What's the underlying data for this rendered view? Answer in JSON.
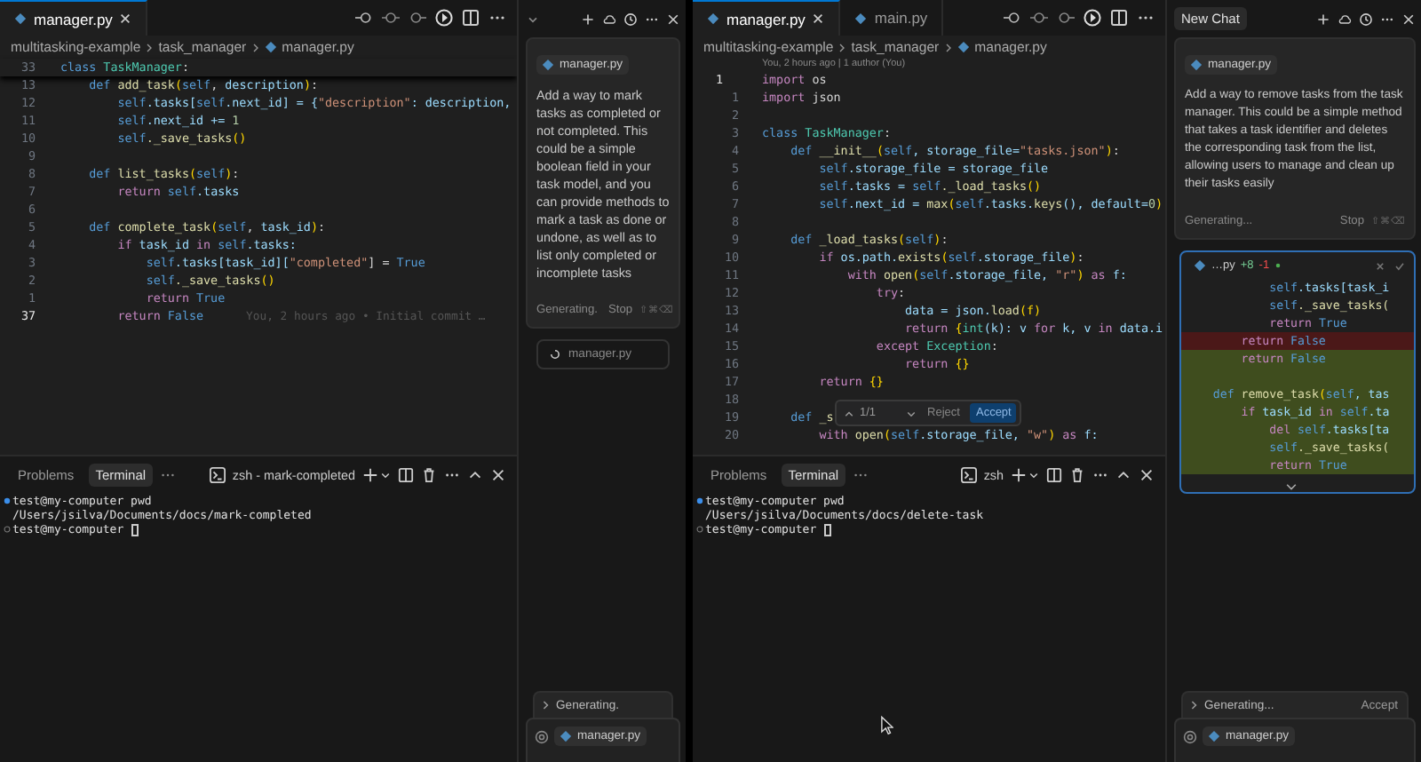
{
  "panes": [
    {
      "editor": {
        "tabs": [
          {
            "label": "manager.py",
            "selected": true
          }
        ],
        "breadcrumbs": [
          "multitasking-example",
          "task_manager",
          "manager.py"
        ],
        "lines": [
          {
            "number": "33",
            "current": false,
            "tokens": [
              {
                "text": "class ",
                "kind": "kw"
              },
              {
                "text": "TaskManager",
                "kind": "cls"
              },
              {
                "text": ":",
                "kind": "pl"
              }
            ]
          },
          {
            "number": "13",
            "current": false,
            "tokens": [
              {
                "text": "    def ",
                "kind": "kw"
              },
              {
                "text": "add_task",
                "kind": "fn"
              },
              {
                "text": "(",
                "kind": "br"
              },
              {
                "text": "self",
                "kind": "kw"
              },
              {
                "text": ", ",
                "kind": "pl"
              },
              {
                "text": "description",
                "kind": "var"
              },
              {
                "text": ")",
                "kind": "br"
              },
              {
                "text": ":",
                "kind": "pl"
              }
            ]
          },
          {
            "number": "12",
            "current": false,
            "tokens": [
              {
                "text": "        self",
                "kind": "kw"
              },
              {
                "text": ".tasks[",
                "kind": "var"
              },
              {
                "text": "self",
                "kind": "kw"
              },
              {
                "text": ".next_id] = {",
                "kind": "var"
              },
              {
                "text": "\"description\"",
                "kind": "str"
              },
              {
                "text": ": description,",
                "kind": "var"
              }
            ]
          },
          {
            "number": "11",
            "current": false,
            "tokens": [
              {
                "text": "        self",
                "kind": "kw"
              },
              {
                "text": ".next_id += ",
                "kind": "var"
              },
              {
                "text": "1",
                "kind": "num"
              }
            ]
          },
          {
            "number": "10",
            "current": false,
            "tokens": [
              {
                "text": "        self",
                "kind": "kw"
              },
              {
                "text": "._save_tasks",
                "kind": "fn"
              },
              {
                "text": "()",
                "kind": "br"
              }
            ]
          },
          {
            "number": "9",
            "current": false
          },
          {
            "number": "8",
            "current": false,
            "tokens": [
              {
                "text": "    def ",
                "kind": "kw"
              },
              {
                "text": "list_tasks",
                "kind": "fn"
              },
              {
                "text": "(",
                "kind": "br"
              },
              {
                "text": "self",
                "kind": "kw"
              },
              {
                "text": ")",
                "kind": "br"
              },
              {
                "text": ":",
                "kind": "pl"
              }
            ]
          },
          {
            "number": "7",
            "current": false,
            "tokens": [
              {
                "text": "        return ",
                "kind": "ctl"
              },
              {
                "text": "self",
                "kind": "kw"
              },
              {
                "text": ".tasks",
                "kind": "var"
              }
            ]
          },
          {
            "number": "6",
            "current": false
          },
          {
            "number": "5",
            "current": false,
            "tokens": [
              {
                "text": "    def ",
                "kind": "kw"
              },
              {
                "text": "complete_task",
                "kind": "fn"
              },
              {
                "text": "(",
                "kind": "br"
              },
              {
                "text": "self",
                "kind": "kw"
              },
              {
                "text": ", ",
                "kind": "pl"
              },
              {
                "text": "task_id",
                "kind": "var"
              },
              {
                "text": ")",
                "kind": "br"
              },
              {
                "text": ":",
                "kind": "pl"
              }
            ]
          },
          {
            "number": "4",
            "current": false,
            "tokens": [
              {
                "text": "        if ",
                "kind": "ctl"
              },
              {
                "text": "task_id ",
                "kind": "var"
              },
              {
                "text": "in ",
                "kind": "ctl"
              },
              {
                "text": "self",
                "kind": "kw"
              },
              {
                "text": ".tasks:",
                "kind": "var"
              }
            ]
          },
          {
            "number": "3",
            "current": false,
            "tokens": [
              {
                "text": "            self",
                "kind": "kw"
              },
              {
                "text": ".tasks[task_id][",
                "kind": "var"
              },
              {
                "text": "\"completed\"",
                "kind": "str"
              },
              {
                "text": "] = ",
                "kind": "pl"
              },
              {
                "text": "True",
                "kind": "kw"
              }
            ]
          },
          {
            "number": "2",
            "current": false,
            "tokens": [
              {
                "text": "            self",
                "kind": "kw"
              },
              {
                "text": "._save_tasks",
                "kind": "fn"
              },
              {
                "text": "()",
                "kind": "br"
              }
            ]
          },
          {
            "number": "1",
            "current": false,
            "tokens": [
              {
                "text": "            return ",
                "kind": "ctl"
              },
              {
                "text": "True",
                "kind": "kw"
              }
            ]
          },
          {
            "number": "37",
            "current": true,
            "tokens": [
              {
                "text": "        return ",
                "kind": "ctl"
              },
              {
                "text": "False",
                "kind": "kw"
              }
            ],
            "blame": "You, 2 hours ago • Initial commit …"
          }
        ]
      },
      "terminal": {
        "tabs": [
          {
            "label": "Problems",
            "selected": false
          },
          {
            "label": "Terminal",
            "selected": true
          }
        ],
        "shell": "zsh - mark-completed",
        "lines": [
          {
            "kind": "command",
            "text": "test@my-computer pwd"
          },
          {
            "kind": "output",
            "text": "/Users/jsilva/Documents/docs/mark-completed"
          },
          {
            "kind": "prompt",
            "text": "test@my-computer"
          }
        ]
      },
      "chat": {
        "message": {
          "file": "manager.py",
          "text": "Add a way to mark tasks as completed or not completed. This could be a simple boolean field in your task model, and you can provide methods to mark a task as done or undone, as well as to list only completed or incomplete tasks",
          "status": "Generating.",
          "stop": "Stop",
          "shortcut": "⇧⌘⌫"
        },
        "pending_file": "manager.py",
        "footer": {
          "status": "Generating."
        },
        "composer": {
          "file": "manager.py"
        }
      }
    },
    {
      "editor": {
        "tabs": [
          {
            "label": "manager.py",
            "selected": true
          },
          {
            "label": "main.py",
            "selected": false
          }
        ],
        "breadcrumbs": [
          "multitasking-example",
          "task_manager",
          "manager.py"
        ],
        "blame_header": "You, 2 hours ago | 1 author (You)",
        "lines": [
          {
            "number": "1",
            "current": true,
            "tokens": [
              {
                "text": "import ",
                "kind": "ctl"
              },
              {
                "text": "os",
                "kind": "pl"
              }
            ]
          },
          {
            "number": "1",
            "current": false,
            "tokens": [
              {
                "text": "import ",
                "kind": "ctl"
              },
              {
                "text": "json",
                "kind": "pl"
              }
            ]
          },
          {
            "number": "2",
            "current": false
          },
          {
            "number": "3",
            "current": false,
            "tokens": [
              {
                "text": "class ",
                "kind": "kw"
              },
              {
                "text": "TaskManager",
                "kind": "cls"
              },
              {
                "text": ":",
                "kind": "pl"
              }
            ]
          },
          {
            "number": "4",
            "current": false,
            "tokens": [
              {
                "text": "    def ",
                "kind": "kw"
              },
              {
                "text": "__init__",
                "kind": "fn"
              },
              {
                "text": "(",
                "kind": "br"
              },
              {
                "text": "self",
                "kind": "kw"
              },
              {
                "text": ", storage_file=",
                "kind": "var"
              },
              {
                "text": "\"tasks.json\"",
                "kind": "str"
              },
              {
                "text": ")",
                "kind": "br"
              },
              {
                "text": ":",
                "kind": "pl"
              }
            ]
          },
          {
            "number": "5",
            "current": false,
            "tokens": [
              {
                "text": "        self",
                "kind": "kw"
              },
              {
                "text": ".storage_file = storage_file",
                "kind": "var"
              }
            ]
          },
          {
            "number": "6",
            "current": false,
            "tokens": [
              {
                "text": "        self",
                "kind": "kw"
              },
              {
                "text": ".tasks = ",
                "kind": "var"
              },
              {
                "text": "self",
                "kind": "kw"
              },
              {
                "text": "._load_tasks",
                "kind": "fn"
              },
              {
                "text": "()",
                "kind": "br"
              }
            ]
          },
          {
            "number": "7",
            "current": false,
            "tokens": [
              {
                "text": "        self",
                "kind": "kw"
              },
              {
                "text": ".next_id = ",
                "kind": "var"
              },
              {
                "text": "max",
                "kind": "fn"
              },
              {
                "text": "(",
                "kind": "br"
              },
              {
                "text": "self",
                "kind": "kw"
              },
              {
                "text": ".tasks.",
                "kind": "var"
              },
              {
                "text": "keys",
                "kind": "fn"
              },
              {
                "text": "(), default=",
                "kind": "var"
              },
              {
                "text": "0",
                "kind": "num"
              },
              {
                "text": ")",
                "kind": "br"
              }
            ]
          },
          {
            "number": "8",
            "current": false
          },
          {
            "number": "9",
            "current": false,
            "tokens": [
              {
                "text": "    def ",
                "kind": "kw"
              },
              {
                "text": "_load_tasks",
                "kind": "fn"
              },
              {
                "text": "(",
                "kind": "br"
              },
              {
                "text": "self",
                "kind": "kw"
              },
              {
                "text": ")",
                "kind": "br"
              },
              {
                "text": ":",
                "kind": "pl"
              }
            ]
          },
          {
            "number": "10",
            "current": false,
            "tokens": [
              {
                "text": "        if ",
                "kind": "ctl"
              },
              {
                "text": "os.path.",
                "kind": "var"
              },
              {
                "text": "exists",
                "kind": "fn"
              },
              {
                "text": "(",
                "kind": "br"
              },
              {
                "text": "self",
                "kind": "kw"
              },
              {
                "text": ".storage_file",
                "kind": "var"
              },
              {
                "text": ")",
                "kind": "br"
              },
              {
                "text": ":",
                "kind": "pl"
              }
            ]
          },
          {
            "number": "11",
            "current": false,
            "tokens": [
              {
                "text": "            with ",
                "kind": "ctl"
              },
              {
                "text": "open",
                "kind": "fn"
              },
              {
                "text": "(",
                "kind": "br"
              },
              {
                "text": "self",
                "kind": "kw"
              },
              {
                "text": ".storage_file, ",
                "kind": "var"
              },
              {
                "text": "\"r\"",
                "kind": "str"
              },
              {
                "text": ") ",
                "kind": "br"
              },
              {
                "text": "as ",
                "kind": "ctl"
              },
              {
                "text": "f:",
                "kind": "var"
              }
            ]
          },
          {
            "number": "12",
            "current": false,
            "tokens": [
              {
                "text": "                try",
                "kind": "ctl"
              },
              {
                "text": ":",
                "kind": "pl"
              }
            ]
          },
          {
            "number": "13",
            "current": false,
            "tokens": [
              {
                "text": "                    data = json.",
                "kind": "var"
              },
              {
                "text": "load",
                "kind": "fn"
              },
              {
                "text": "(f)",
                "kind": "br"
              }
            ]
          },
          {
            "number": "14",
            "current": false,
            "tokens": [
              {
                "text": "                    return ",
                "kind": "ctl"
              },
              {
                "text": "{",
                "kind": "br"
              },
              {
                "text": "int",
                "kind": "cls"
              },
              {
                "text": "(k): v ",
                "kind": "var"
              },
              {
                "text": "for ",
                "kind": "ctl"
              },
              {
                "text": "k, v ",
                "kind": "var"
              },
              {
                "text": "in ",
                "kind": "ctl"
              },
              {
                "text": "data.i",
                "kind": "var"
              }
            ]
          },
          {
            "number": "15",
            "current": false,
            "tokens": [
              {
                "text": "                except ",
                "kind": "ctl"
              },
              {
                "text": "Exception",
                "kind": "cls"
              },
              {
                "text": ":",
                "kind": "pl"
              }
            ]
          },
          {
            "number": "16",
            "current": false,
            "tokens": [
              {
                "text": "                    return ",
                "kind": "ctl"
              },
              {
                "text": "{}",
                "kind": "br"
              }
            ]
          },
          {
            "number": "17",
            "current": false,
            "tokens": [
              {
                "text": "        return ",
                "kind": "ctl"
              },
              {
                "text": "{}",
                "kind": "br"
              }
            ]
          },
          {
            "number": "18",
            "current": false
          },
          {
            "number": "19",
            "current": false,
            "tokens": [
              {
                "text": "    def ",
                "kind": "kw"
              },
              {
                "text": "_s",
                "kind": "fn"
              }
            ]
          },
          {
            "number": "20",
            "current": false,
            "tokens": [
              {
                "text": "        with ",
                "kind": "ctl"
              },
              {
                "text": "open",
                "kind": "fn"
              },
              {
                "text": "(",
                "kind": "br"
              },
              {
                "text": "self",
                "kind": "kw"
              },
              {
                "text": ".storage_file, ",
                "kind": "var"
              },
              {
                "text": "\"w\"",
                "kind": "str"
              },
              {
                "text": ") ",
                "kind": "br"
              },
              {
                "text": "as ",
                "kind": "ctl"
              },
              {
                "text": "f:",
                "kind": "var"
              }
            ]
          }
        ],
        "review": {
          "counter": "1/1",
          "reject": "Reject",
          "accept": "Accept"
        }
      },
      "terminal": {
        "tabs": [
          {
            "label": "Problems",
            "selected": false
          },
          {
            "label": "Terminal",
            "selected": true
          }
        ],
        "shell": "zsh",
        "lines": [
          {
            "kind": "command",
            "text": "test@my-computer pwd"
          },
          {
            "kind": "output",
            "text": "/Users/jsilva/Documents/docs/delete-task"
          },
          {
            "kind": "prompt",
            "text": "test@my-computer"
          }
        ]
      },
      "chat": {
        "title": "New Chat",
        "message": {
          "file": "manager.py",
          "text": "Add a way to remove tasks from the task manager. This could be a simple method that takes a task identifier and deletes the corresponding task from the list, allowing users to manage and clean up their tasks easily",
          "status": "Generating...",
          "stop": "Stop",
          "shortcut": "⇧⌘⌫"
        },
        "diff": {
          "file": "…py",
          "added": "+8",
          "removed": "-1",
          "lines": [
            {
              "kind": "context",
              "tokens": [
                {
                  "text": "            self",
                  "kind": "kw"
                },
                {
                  "text": ".tasks[task_i",
                  "kind": "var"
                }
              ]
            },
            {
              "kind": "context",
              "tokens": [
                {
                  "text": "            self",
                  "kind": "kw"
                },
                {
                  "text": "._save_tasks(",
                  "kind": "fn"
                }
              ]
            },
            {
              "kind": "context",
              "tokens": [
                {
                  "text": "            return ",
                  "kind": "ctl"
                },
                {
                  "text": "True",
                  "kind": "kw"
                }
              ]
            },
            {
              "kind": "removed",
              "tokens": [
                {
                  "text": "        return ",
                  "kind": "ctl"
                },
                {
                  "text": "False",
                  "kind": "kw"
                }
              ]
            },
            {
              "kind": "added",
              "tokens": [
                {
                  "text": "        return ",
                  "kind": "ctl"
                },
                {
                  "text": "False",
                  "kind": "kw"
                }
              ]
            },
            {
              "kind": "added"
            },
            {
              "kind": "added",
              "tokens": [
                {
                  "text": "    def ",
                  "kind": "kw"
                },
                {
                  "text": "remove_task",
                  "kind": "fn"
                },
                {
                  "text": "(",
                  "kind": "br"
                },
                {
                  "text": "self",
                  "kind": "kw"
                },
                {
                  "text": ", tas",
                  "kind": "var"
                }
              ]
            },
            {
              "kind": "added",
              "tokens": [
                {
                  "text": "        if ",
                  "kind": "ctl"
                },
                {
                  "text": "task_id ",
                  "kind": "var"
                },
                {
                  "text": "in ",
                  "kind": "ctl"
                },
                {
                  "text": "self",
                  "kind": "kw"
                },
                {
                  "text": ".ta",
                  "kind": "var"
                }
              ]
            },
            {
              "kind": "added",
              "tokens": [
                {
                  "text": "            del ",
                  "kind": "ctl"
                },
                {
                  "text": "self",
                  "kind": "kw"
                },
                {
                  "text": ".tasks[ta",
                  "kind": "var"
                }
              ]
            },
            {
              "kind": "added",
              "tokens": [
                {
                  "text": "            self",
                  "kind": "kw"
                },
                {
                  "text": "._save_tasks(",
                  "kind": "fn"
                }
              ]
            },
            {
              "kind": "added",
              "tokens": [
                {
                  "text": "            return ",
                  "kind": "ctl"
                },
                {
                  "text": "True",
                  "kind": "kw"
                }
              ]
            }
          ]
        },
        "footer": {
          "status": "Generating...",
          "action": "Accept"
        },
        "composer": {
          "file": "manager.py"
        }
      }
    }
  ]
}
